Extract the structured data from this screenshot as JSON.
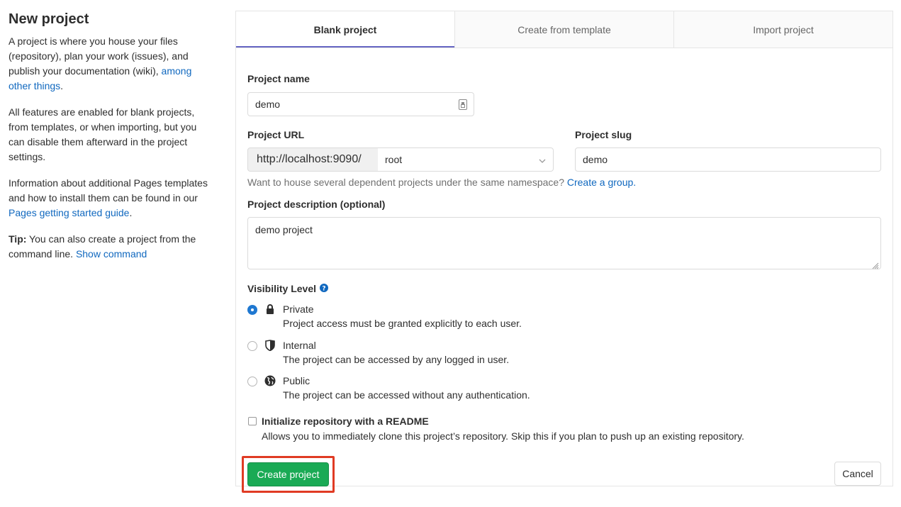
{
  "left": {
    "title": "New project",
    "p1_text": "A project is where you house your files (repository), plan your work (issues), and publish your documentation (wiki), ",
    "p1_link": "among other things",
    "p1_end": ".",
    "p2": "All features are enabled for blank projects, from templates, or when importing, but you can disable them afterward in the project settings.",
    "p3_text": "Information about additional Pages templates and how to install them can be found in our ",
    "p3_link": "Pages getting started guide",
    "p3_end": ".",
    "tip_label": "Tip:",
    "tip_text": " You can also create a project from the command line. ",
    "tip_link": "Show command"
  },
  "tabs": [
    {
      "label": "Blank project",
      "active": true
    },
    {
      "label": "Create from template",
      "active": false
    },
    {
      "label": "Import project",
      "active": false
    }
  ],
  "form": {
    "project_name_label": "Project name",
    "project_name_value": "demo",
    "project_url_label": "Project URL",
    "url_prefix": "http://localhost:9090/",
    "namespace": "root",
    "project_slug_label": "Project slug",
    "project_slug_value": "demo",
    "namespace_help": "Want to house several dependent projects under the same namespace? ",
    "namespace_help_link": "Create a group.",
    "description_label": "Project description (optional)",
    "description_value": "demo project",
    "visibility_label": "Visibility Level",
    "visibility": [
      {
        "title": "Private",
        "desc": "Project access must be granted explicitly to each user.",
        "icon": "lock-icon",
        "checked": true
      },
      {
        "title": "Internal",
        "desc": "The project can be accessed by any logged in user.",
        "icon": "shield-icon",
        "checked": false
      },
      {
        "title": "Public",
        "desc": "The project can be accessed without any authentication.",
        "icon": "globe-icon",
        "checked": false
      }
    ],
    "readme_label": "Initialize repository with a README",
    "readme_desc": "Allows you to immediately clone this project’s repository. Skip this if you plan to push up an existing repository.",
    "create_button": "Create project",
    "cancel_button": "Cancel"
  },
  "colors": {
    "link": "#1068bf",
    "primary_button": "#1aaa55",
    "radio_checked": "#1f78d1",
    "active_tab_underline": "#6666c4",
    "highlight_box": "#e03b24"
  }
}
